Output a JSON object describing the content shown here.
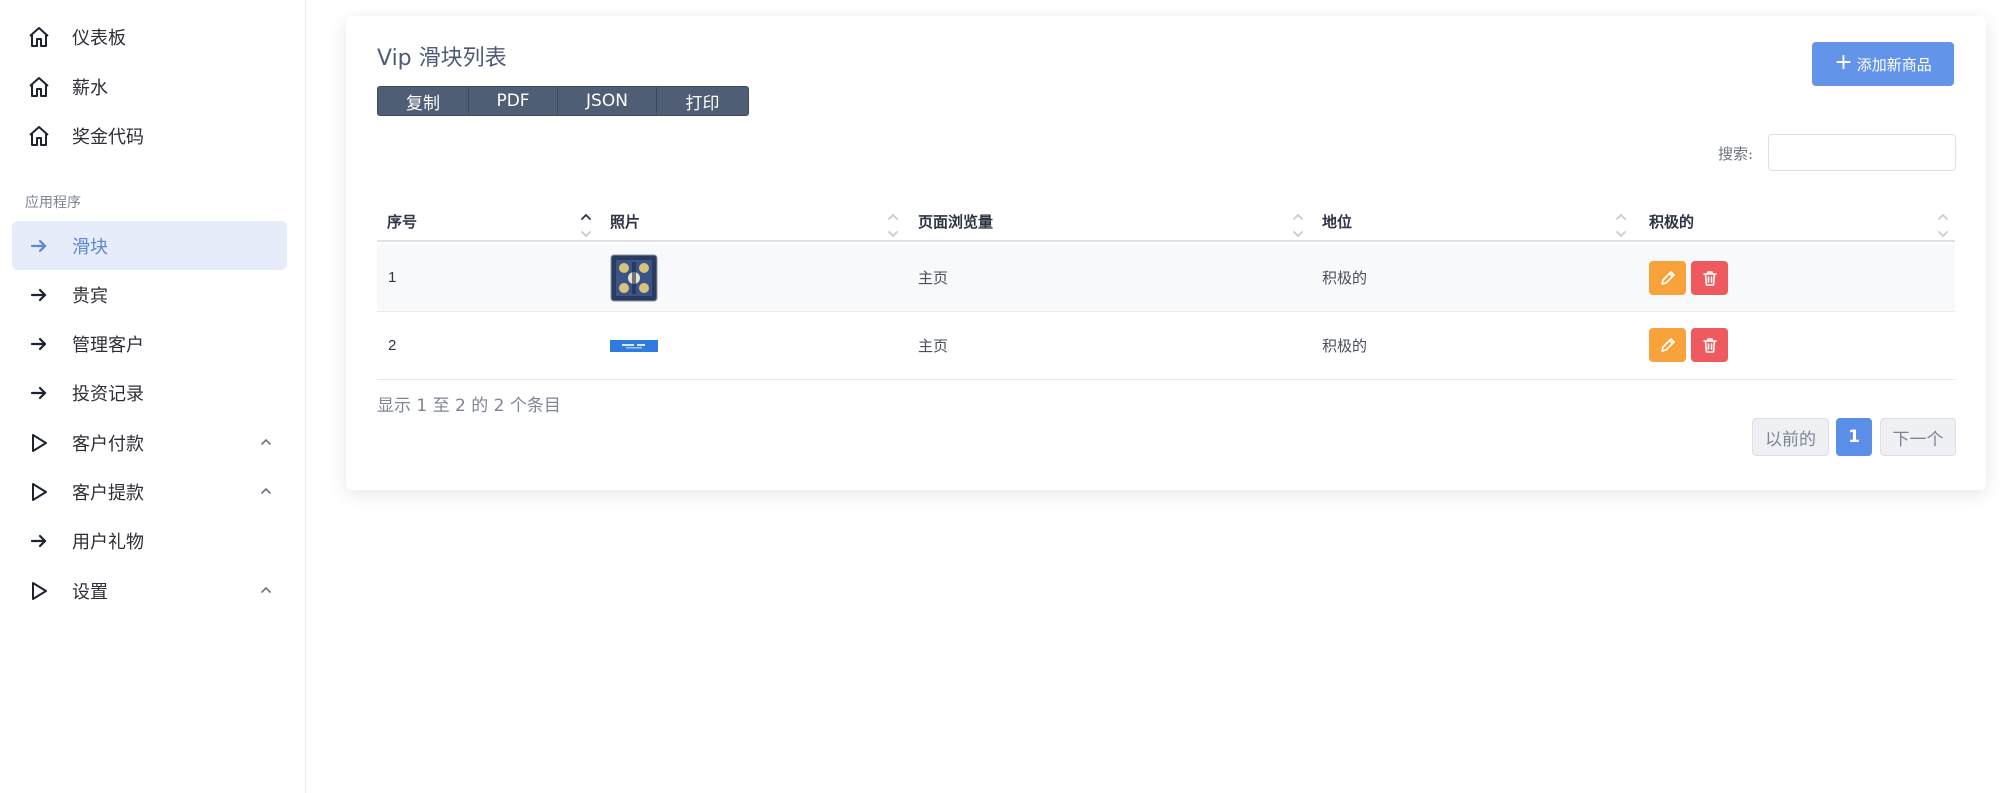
{
  "sidebar": {
    "items": [
      {
        "label": "仪表板",
        "icon": "home-icon"
      },
      {
        "label": "薪水",
        "icon": "home-icon"
      },
      {
        "label": "奖金代码",
        "icon": "home-icon"
      },
      {
        "label": "滑块",
        "icon": "arrow-right-icon",
        "active": true
      },
      {
        "label": "贵宾",
        "icon": "arrow-right-icon"
      },
      {
        "label": "管理客户",
        "icon": "arrow-right-icon"
      },
      {
        "label": "投资记录",
        "icon": "arrow-right-icon"
      },
      {
        "label": "客户付款",
        "icon": "play-icon",
        "expandable": true
      },
      {
        "label": "客户提款",
        "icon": "play-icon",
        "expandable": true
      },
      {
        "label": "用户礼物",
        "icon": "arrow-right-icon"
      },
      {
        "label": "设置",
        "icon": "play-icon",
        "expandable": true
      }
    ],
    "section_title": "应用程序"
  },
  "main": {
    "title": "Vip 滑块列表",
    "export_buttons": [
      "复制",
      "PDF",
      "JSON",
      "打印"
    ],
    "add_button": "添加新商品",
    "search_label": "搜索:",
    "search_value": "",
    "table": {
      "columns": [
        "序号",
        "照片",
        "页面浏览量",
        "地位",
        "积极的"
      ],
      "rows": [
        {
          "id": "1",
          "page": "主页",
          "status": "积极的"
        },
        {
          "id": "2",
          "page": "主页",
          "status": "积极的"
        }
      ]
    },
    "info": "显示 1 至 2 的 2 个条目",
    "pagination": {
      "prev": "以前的",
      "current": "1",
      "next": "下一个"
    }
  },
  "colors": {
    "accent": "#6494ea",
    "active_nav_bg": "#e6ecfa",
    "edit": "#f7a23a",
    "delete": "#ef5a5f"
  }
}
